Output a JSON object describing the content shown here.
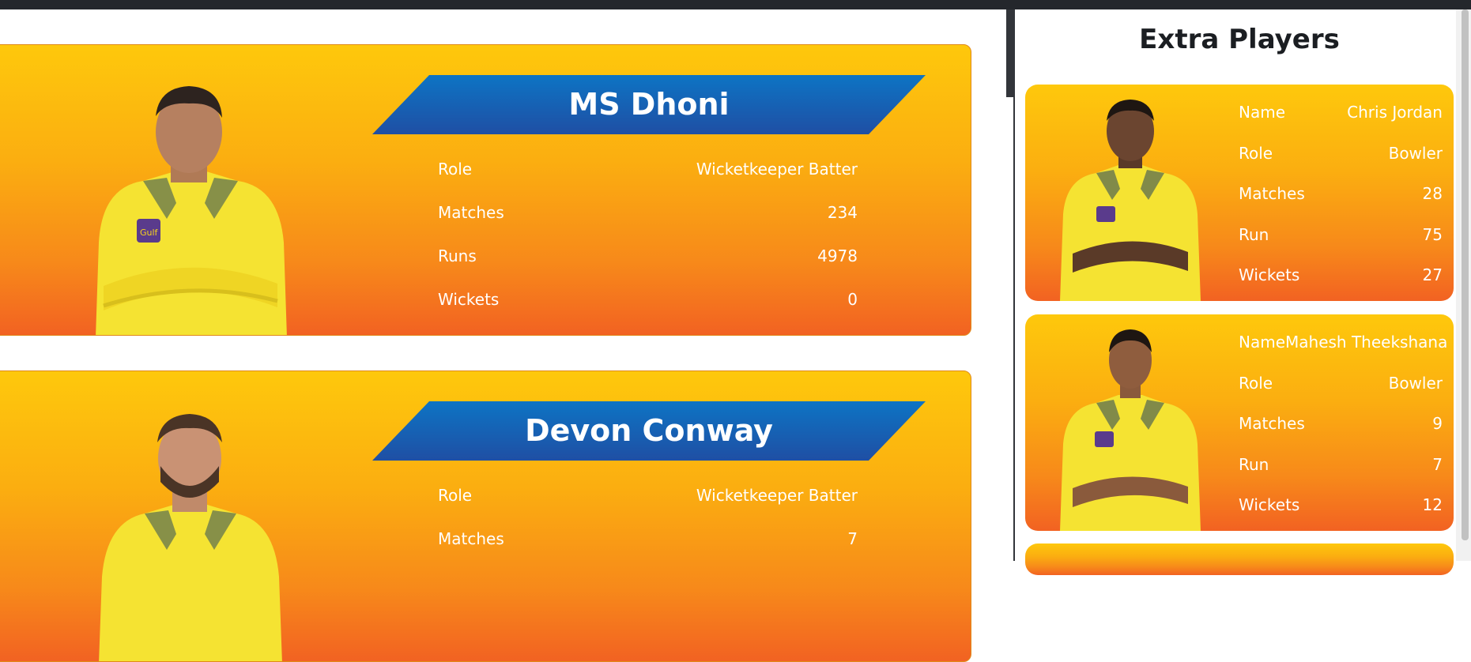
{
  "main": {
    "players": [
      {
        "name": "MS Dhoni",
        "stats": [
          {
            "label": "Role",
            "value": "Wicketkeeper Batter"
          },
          {
            "label": "Matches",
            "value": "234"
          },
          {
            "label": "Runs",
            "value": "4978"
          },
          {
            "label": "Wickets",
            "value": "0"
          }
        ]
      },
      {
        "name": "Devon Conway",
        "stats": [
          {
            "label": "Role",
            "value": "Wicketkeeper Batter"
          },
          {
            "label": "Matches",
            "value": "7"
          }
        ]
      }
    ]
  },
  "sidebar": {
    "title": "Extra Players",
    "players": [
      {
        "stats": [
          {
            "label": "Name",
            "value": "Chris Jordan"
          },
          {
            "label": "Role",
            "value": "Bowler"
          },
          {
            "label": "Matches",
            "value": "28"
          },
          {
            "label": "Run",
            "value": "75"
          },
          {
            "label": "Wickets",
            "value": "27"
          }
        ]
      },
      {
        "stats": [
          {
            "label": "Name",
            "value": "Mahesh Theekshana"
          },
          {
            "label": "Role",
            "value": "Bowler"
          },
          {
            "label": "Matches",
            "value": "9"
          },
          {
            "label": "Run",
            "value": "7"
          },
          {
            "label": "Wickets",
            "value": "12"
          }
        ]
      }
    ]
  },
  "colors": {
    "card_top": "#fec80c",
    "card_bottom": "#f26222",
    "banner_top": "#0d74c4",
    "banner_bottom": "#1f4fa4",
    "jersey": "#f5e332",
    "skin": "#8a5a3c"
  }
}
